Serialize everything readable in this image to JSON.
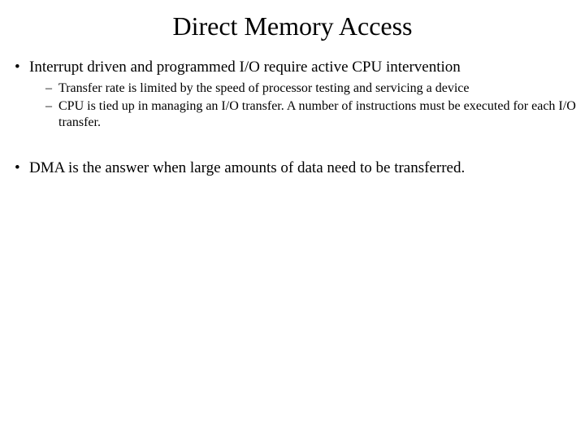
{
  "title": "Direct Memory Access",
  "bullets": [
    {
      "text": "Interrupt driven and programmed I/O require active CPU intervention",
      "sub": [
        "Transfer rate is limited by the speed of processor testing and servicing a device",
        "CPU is tied up in managing an I/O transfer. A number of instructions must be executed for each I/O transfer."
      ]
    },
    {
      "text": "DMA is the answer when large amounts of data need to be transferred.",
      "sub": []
    }
  ]
}
